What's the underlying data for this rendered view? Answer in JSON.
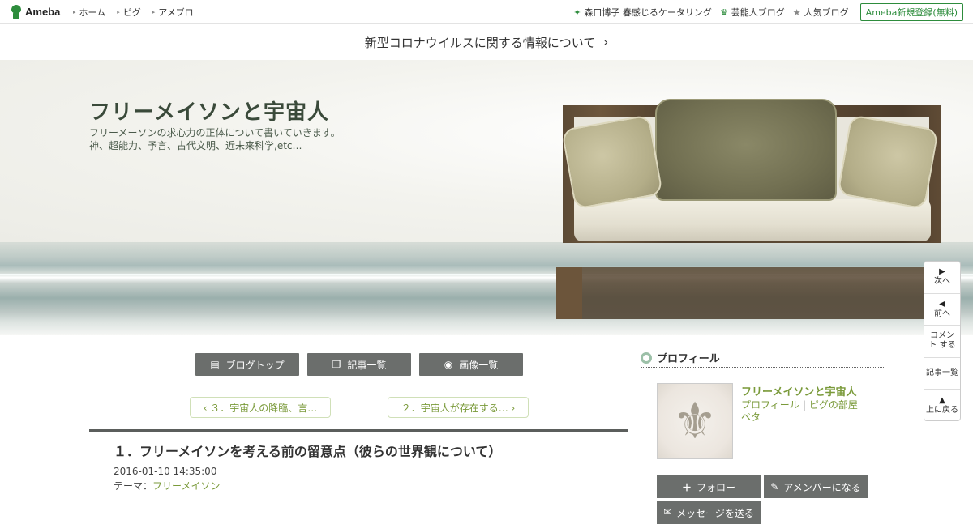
{
  "topbar": {
    "logo_text": "Ameba",
    "nav": [
      "ホーム",
      "ピグ",
      "アメブロ"
    ],
    "right_links": [
      {
        "icon": "sparkle-icon",
        "label": "森口博子 春感じるケータリング"
      },
      {
        "icon": "crown-icon",
        "label": "芸能人ブログ"
      },
      {
        "icon": "star-icon",
        "label": "人気ブログ"
      }
    ],
    "register_label": "Ameba新規登録(無料)"
  },
  "notice": {
    "text": "新型コロナウイルスに関する情報について",
    "chevron": "›"
  },
  "header": {
    "title": "フリーメイソンと宇宙人",
    "desc_line1": "フリーメーソンの求心力の正体について書いていきます。",
    "desc_line2": "神、超能力、予言、古代文明、近未来科学,etc…"
  },
  "sidenav": [
    {
      "icon": "▶",
      "label": "次へ"
    },
    {
      "icon": "◀",
      "label": "前へ"
    },
    {
      "icon": "",
      "label": "コメント する"
    },
    {
      "icon": "",
      "label": "記事一覧"
    },
    {
      "icon": "▲",
      "label": "上に戻る"
    }
  ],
  "blog_nav": [
    {
      "icon": "document-icon",
      "glyph": "▤",
      "label": "ブログトップ"
    },
    {
      "icon": "copy-icon",
      "glyph": "❐",
      "label": "記事一覧"
    },
    {
      "icon": "camera-icon",
      "glyph": "◉",
      "label": "画像一覧"
    }
  ],
  "pager": {
    "prev": "‹ ３．宇宙人の降臨、言…",
    "next": "２．宇宙人が存在する… ›"
  },
  "entry": {
    "title": "１．フリーメイソンを考える前の留意点（彼らの世界観について）",
    "date": "2016-01-10 14:35:00",
    "theme_label": "テーマ：",
    "theme_value": "フリーメイソン"
  },
  "profile": {
    "heading": "プロフィール",
    "name": "フリーメイソンと宇宙人",
    "link_profile": "プロフィール",
    "link_pig": "ピグの部屋",
    "link_peta": "ペタ",
    "follow_label": "フォロー",
    "member_label": "アメンバーになる",
    "message_label": "メッセージを送る"
  },
  "colors": {
    "accent": "#2d8c3c",
    "link_green": "#7a9a3a",
    "button_grey": "#6b6e6c"
  }
}
